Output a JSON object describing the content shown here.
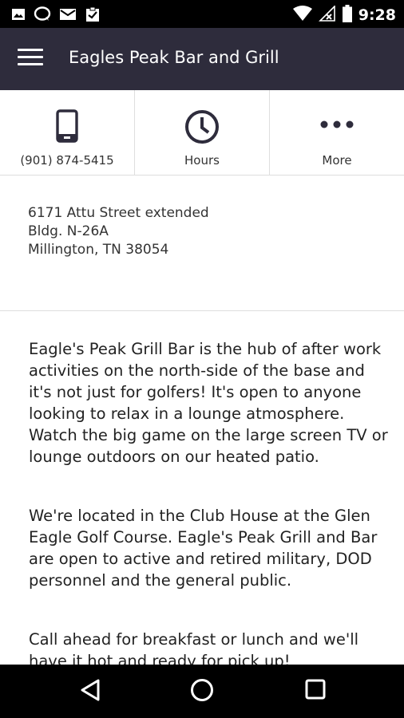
{
  "status_bar": {
    "time": "9:28",
    "left_icons": [
      "image-icon",
      "chat-icon",
      "mail-icon",
      "clipboard-check-icon"
    ],
    "right_icons": [
      "wifi-icon",
      "no-signal-icon",
      "battery-icon"
    ]
  },
  "app_bar": {
    "title": "Eagles Peak Bar and Grill",
    "menu_icon": "hamburger-menu-icon"
  },
  "actions": [
    {
      "label": "(901) 874-5415",
      "icon": "phone-icon"
    },
    {
      "label": "Hours",
      "icon": "clock-icon"
    },
    {
      "label": "More",
      "icon": "more-dots-icon"
    }
  ],
  "address": {
    "line1": "6171 Attu Street extended",
    "line2": "Bldg. N-26A",
    "line3": "Millington, TN 38054"
  },
  "description": {
    "p1": "Eagle's Peak Grill Bar is the hub of after work activities on the north-side of the base and it's not just for golfers!  It's open to anyone looking to relax in a lounge atmosphere. Watch the big game on the large screen TV or lounge outdoors on our heated patio.",
    "p2": "We're located in the Club House at the Glen Eagle Golf Course. Eagle's Peak Grill and Bar are open to active and retired military, DOD personnel and the general public.",
    "p3": "Call ahead for breakfast or lunch and we'll have it hot and ready for pick up!"
  },
  "nav_bar": {
    "buttons": [
      "back-icon",
      "home-icon",
      "recents-icon"
    ]
  },
  "colors": {
    "app_bar": "#2e2c3c",
    "status_bar": "#000000",
    "nav_bar": "#000000",
    "icon": "#2e2c3c"
  }
}
